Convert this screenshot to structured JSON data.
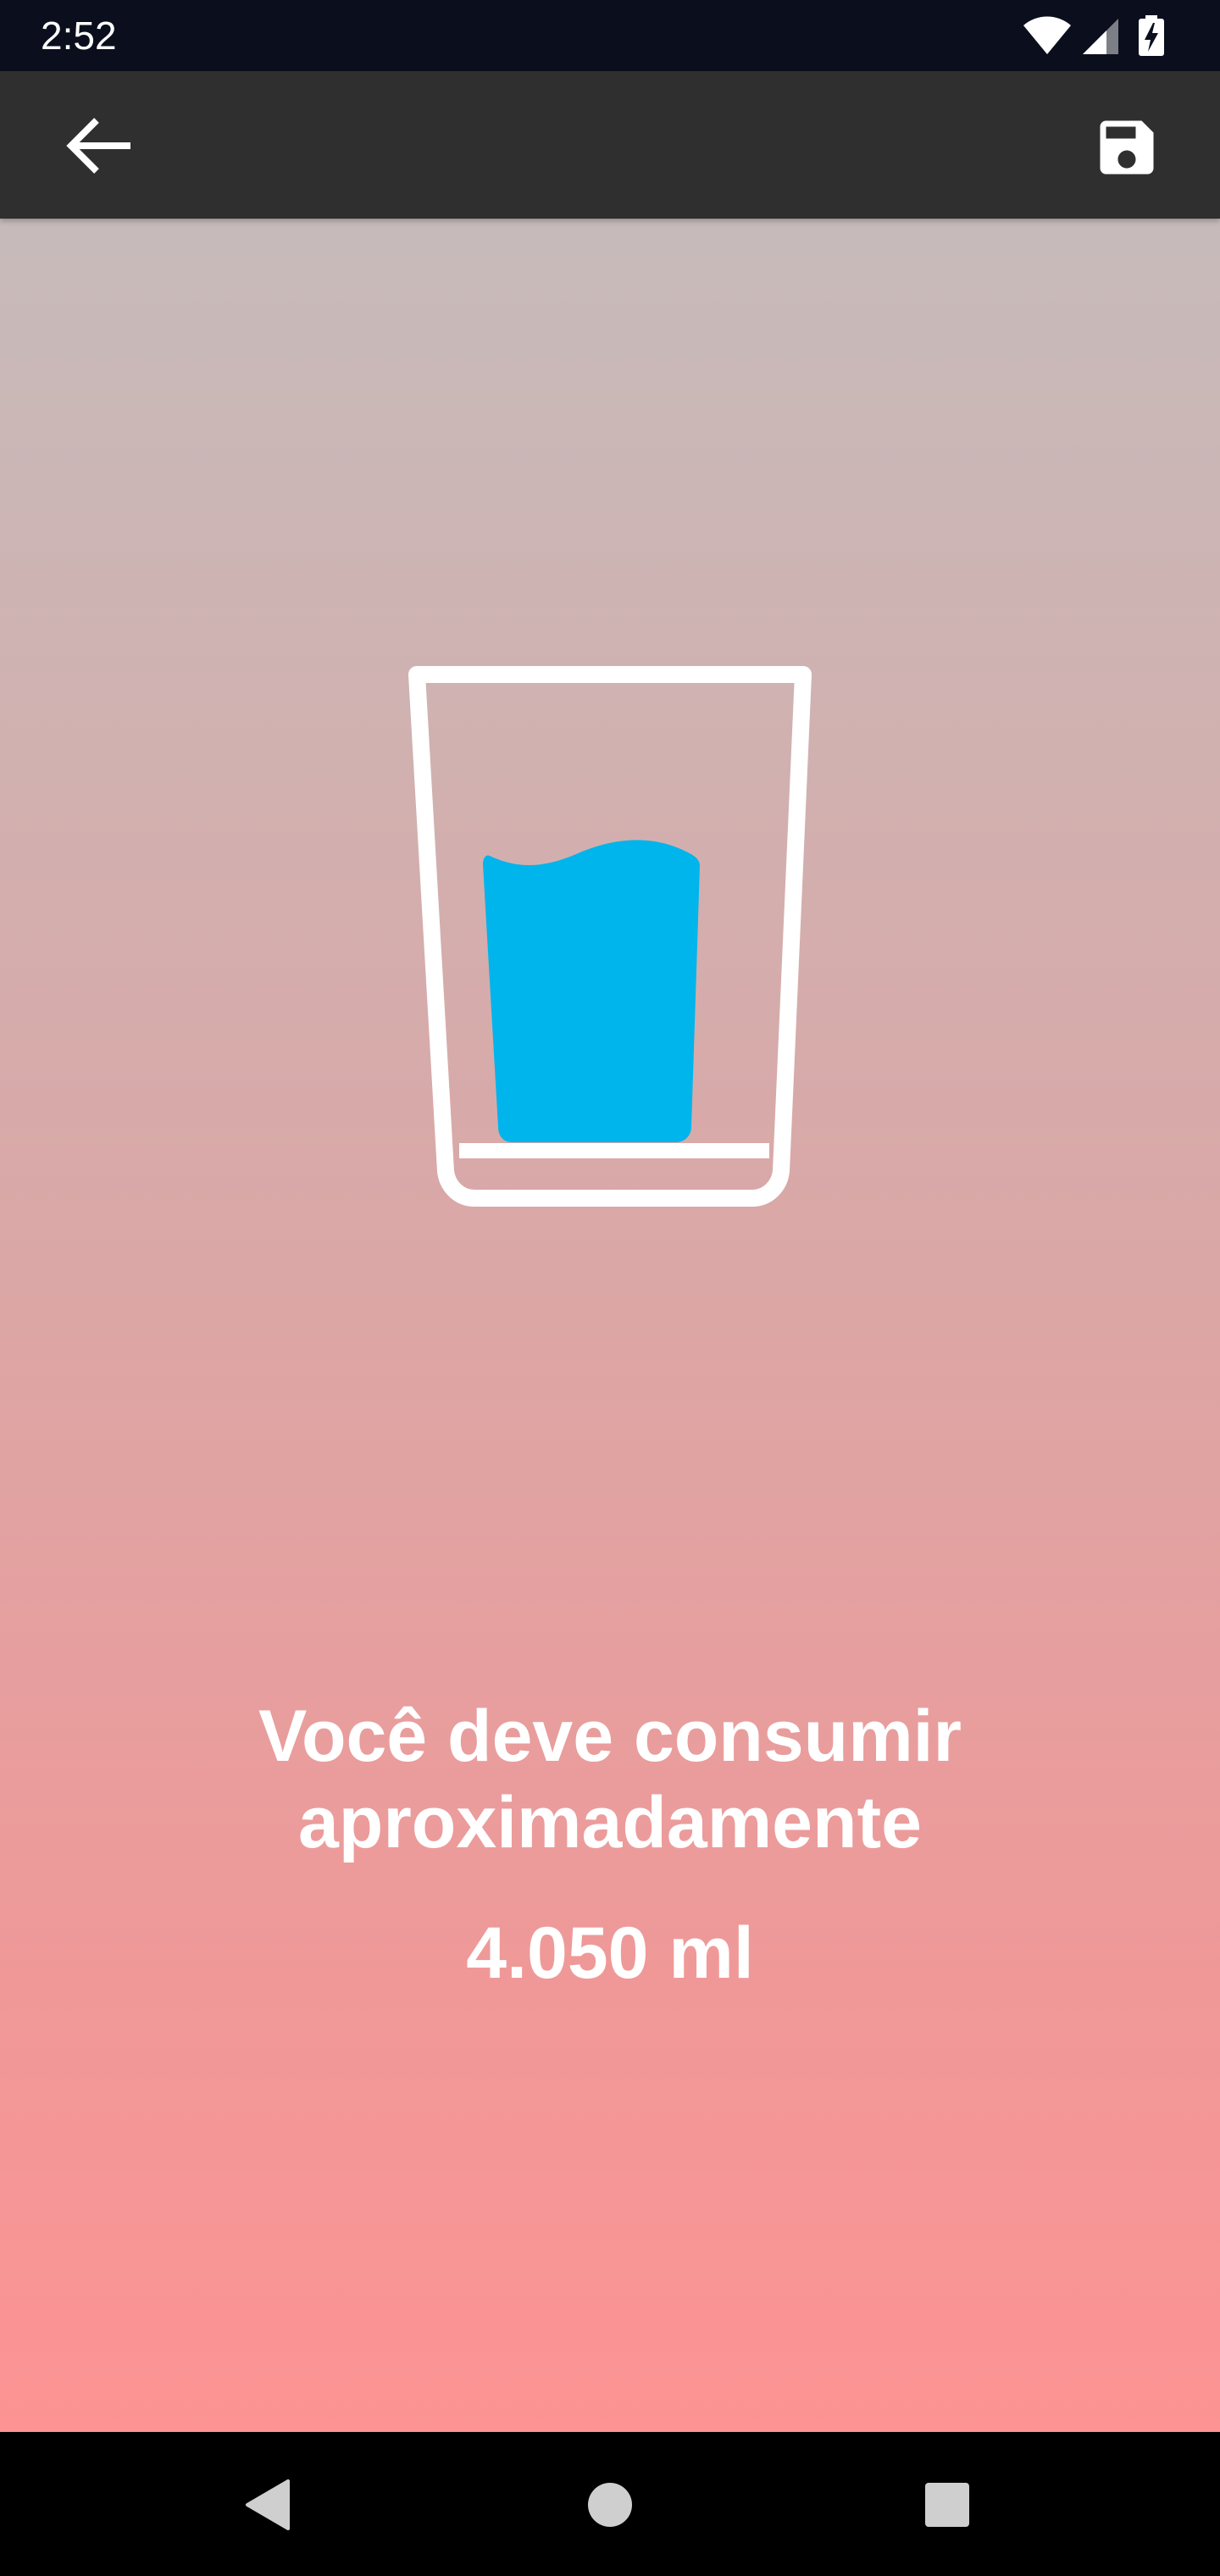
{
  "status_bar": {
    "time": "2:52",
    "icons": [
      "wifi-icon",
      "signal-icon",
      "battery-charging-icon"
    ]
  },
  "toolbar": {
    "back_icon": "arrow-back-icon",
    "save_icon": "save-icon"
  },
  "main": {
    "illustration": "water-glass-icon",
    "message": "Você deve consumir aproximadamente",
    "amount": "4.050 ml"
  },
  "nav_bar": {
    "buttons": [
      "back-triangle-icon",
      "home-circle-icon",
      "recents-square-icon"
    ]
  },
  "colors": {
    "status_bar": "#0b0f1d",
    "toolbar": "#2f2f2f",
    "gradient_top": "#c6bbba",
    "gradient_bottom": "#fd9393",
    "water": "#00b4ec",
    "text": "#ffffff"
  }
}
